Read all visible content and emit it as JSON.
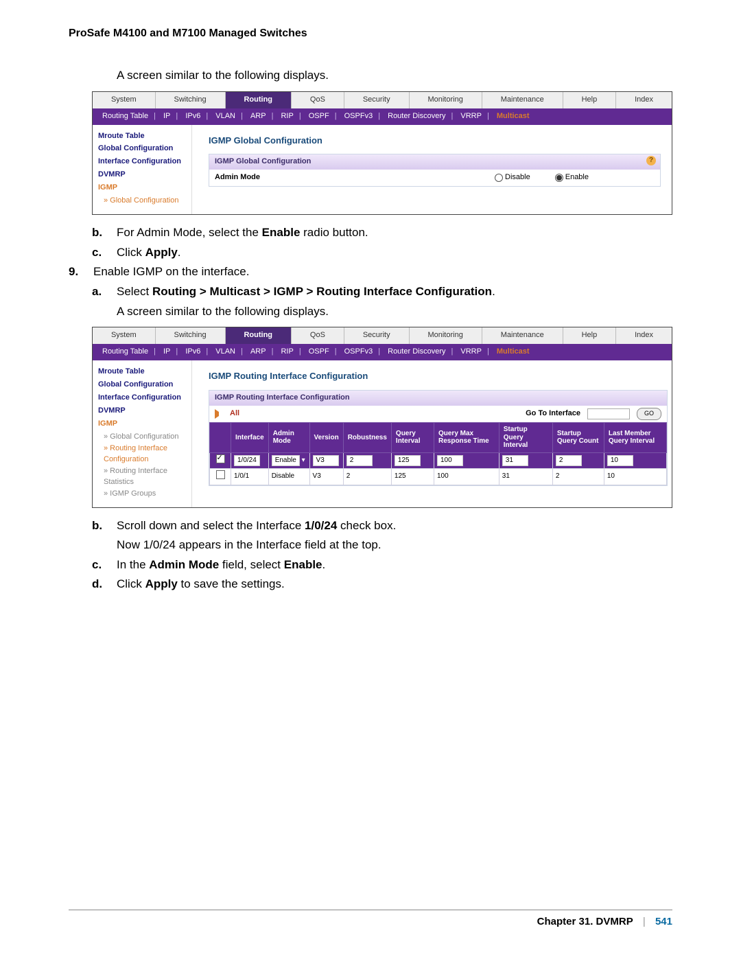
{
  "header": "ProSafe M4100 and M7100 Managed Switches",
  "intro_line": "A screen similar to the following displays.",
  "tabs": [
    "System",
    "Switching",
    "Routing",
    "QoS",
    "Security",
    "Monitoring",
    "Maintenance",
    "Help",
    "Index"
  ],
  "tabs_active_index": 2,
  "subnav": [
    "Routing Table",
    "IP",
    "IPv6",
    "VLAN",
    "ARP",
    "RIP",
    "OSPF",
    "OSPFv3",
    "Router Discovery",
    "VRRP",
    "Multicast"
  ],
  "subnav_active_index": 10,
  "screen1": {
    "side": {
      "items": [
        "Mroute Table",
        "Global Configuration",
        "Interface Configuration",
        "DVMRP",
        "IGMP"
      ],
      "igmp_sub": "» Global Configuration"
    },
    "title": "IGMP Global Configuration",
    "panel_head": "IGMP Global Configuration",
    "row_label": "Admin Mode",
    "opt_disable": "Disable",
    "opt_enable": "Enable"
  },
  "instr": {
    "b1_pre": "For Admin Mode, select the ",
    "b1_bold": "Enable",
    "b1_post": " radio button.",
    "c1_pre": "Click ",
    "c1_bold": "Apply",
    "c1_post": ".",
    "n9": "Enable IGMP on the interface.",
    "a2_pre": "Select ",
    "a2_bold": "Routing > Multicast > IGMP > Routing Interface Configuration",
    "a2_post": ".",
    "a2_followup": "A screen similar to the following displays."
  },
  "screen2": {
    "side": {
      "items": [
        "Mroute Table",
        "Global Configuration",
        "Interface Configuration",
        "DVMRP",
        "IGMP"
      ],
      "subs": [
        "» Global Configuration",
        "» Routing Interface Configuration",
        "» Routing Interface Statistics",
        "» IGMP Groups"
      ]
    },
    "title": "IGMP Routing Interface Configuration",
    "panel_head": "IGMP Routing Interface Configuration",
    "all_label": "All",
    "goto_label": "Go To Interface",
    "go_btn": "GO",
    "columns": [
      "",
      "Interface",
      "Admin Mode",
      "Version",
      "Robustness",
      "Query Interval",
      "Query Max Response Time",
      "Startup Query Interval",
      "Startup Query Count",
      "Last Member Query Interval"
    ],
    "rows": [
      {
        "checked": true,
        "interface": "1/0/24",
        "admin": "Enable",
        "version": "V3",
        "robust": "2",
        "qint": "125",
        "qmax": "100",
        "sqi": "31",
        "sqc": "2",
        "lmqi": "10",
        "style": "dark"
      },
      {
        "checked": false,
        "interface": "1/0/1",
        "admin": "Disable",
        "version": "V3",
        "robust": "2",
        "qint": "125",
        "qmax": "100",
        "sqi": "31",
        "sqc": "2",
        "lmqi": "10",
        "style": "light"
      }
    ]
  },
  "instr2": {
    "b_pre": "Scroll down and select the Interface ",
    "b_bold": "1/0/24",
    "b_post": " check box.",
    "b_follow": "Now 1/0/24 appears in the Interface field at the top.",
    "c_pre": "In the ",
    "c_bold1": "Admin Mode",
    "c_mid": " field, select ",
    "c_bold2": "Enable",
    "c_post": ".",
    "d_pre": "Click ",
    "d_bold": "Apply",
    "d_post": " to save the settings."
  },
  "footer": {
    "chapter": "Chapter 31.  DVMRP",
    "page": "541"
  }
}
